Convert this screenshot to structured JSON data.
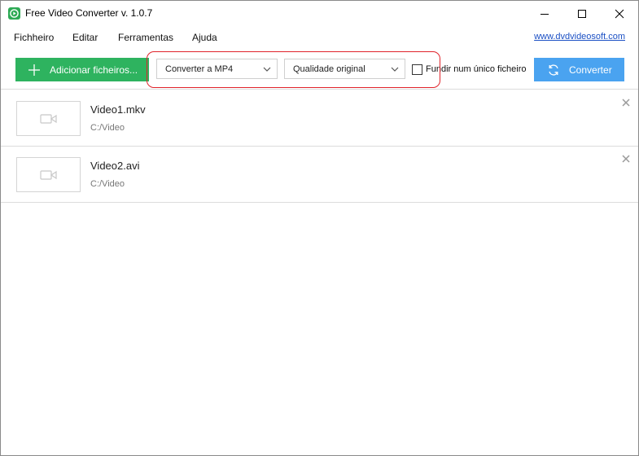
{
  "window": {
    "title": "Free Video Converter v. 1.0.7",
    "icon": "app-logo-icon",
    "controls": [
      "minimize-icon",
      "maximize-icon",
      "close-icon"
    ]
  },
  "menu": {
    "items": [
      "Fichheiro",
      "Editar",
      "Ferramentas",
      "Ajuda"
    ],
    "link": "www.dvdvideosoft.com"
  },
  "toolbar": {
    "add_label": "Adicionar ficheiros...",
    "format_value": "Converter a MP4",
    "quality_value": "Qualidade original",
    "merge_label": "Fundir num único ficheiro",
    "merge_checked": false,
    "convert_label": "Converter"
  },
  "files": [
    {
      "name": "Video1.mkv",
      "path": "C:/Video"
    },
    {
      "name": "Video2.avi",
      "path": "C:/Video"
    }
  ],
  "colors": {
    "add_button": "#2eb35f",
    "convert_button": "#4aa3f0",
    "link": "#1a4fc4",
    "highlight": "#e0242b"
  }
}
